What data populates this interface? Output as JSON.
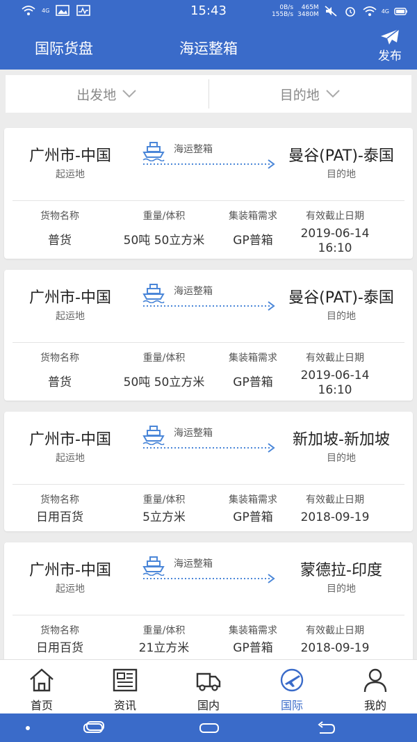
{
  "status_bar": {
    "time": "15:43",
    "net_4g_left": "4G",
    "net_4g_right": "4G",
    "speed_up": "0B/s",
    "speed_down": "155B/s",
    "mem1": "465M",
    "mem2": "3480M"
  },
  "header": {
    "left_tab": "国际货盘",
    "title": "海运整箱",
    "publish_label": "发布"
  },
  "filter": {
    "departure": "出发地",
    "destination": "目的地"
  },
  "cards": [
    {
      "origin": "广州市-中国",
      "origin_label": "起运地",
      "mode": "海运整箱",
      "destination": "曼谷(PAT)-泰国",
      "destination_label": "目的地",
      "col_headers": [
        "货物名称",
        "重量/体积",
        "集装箱需求",
        "有效截止日期"
      ],
      "cargo": "普货",
      "weight": "50吨 50立方米",
      "container": "GP普箱",
      "deadline_date": "2019-06-14",
      "deadline_time": "16:10"
    },
    {
      "origin": "广州市-中国",
      "origin_label": "起运地",
      "mode": "海运整箱",
      "destination": "曼谷(PAT)-泰国",
      "destination_label": "目的地",
      "col_headers": [
        "货物名称",
        "重量/体积",
        "集装箱需求",
        "有效截止日期"
      ],
      "cargo": "普货",
      "weight": "50吨 50立方米",
      "container": "GP普箱",
      "deadline_date": "2019-06-14",
      "deadline_time": "16:10"
    },
    {
      "origin": "广州市-中国",
      "origin_label": "起运地",
      "mode": "海运整箱",
      "destination": "新加坡-新加坡",
      "destination_label": "目的地",
      "col_headers": [
        "货物名称",
        "重量/体积",
        "集装箱需求",
        "有效截止日期"
      ],
      "cargo": "日用百货",
      "weight": "5立方米",
      "container": "GP普箱",
      "deadline_date": "2018-09-19",
      "deadline_time": ""
    },
    {
      "origin": "广州市-中国",
      "origin_label": "起运地",
      "mode": "海运整箱",
      "destination": "蒙德拉-印度",
      "destination_label": "目的地",
      "col_headers": [
        "货物名称",
        "重量/体积",
        "集装箱需求",
        "有效截止日期"
      ],
      "cargo": "日用百货",
      "weight": "21立方米",
      "container": "GP普箱",
      "deadline_date": "2018-09-19",
      "deadline_time": ""
    }
  ],
  "bottom_nav": [
    {
      "label": "首页",
      "icon": "house-icon"
    },
    {
      "label": "资讯",
      "icon": "newspaper-icon"
    },
    {
      "label": "国内",
      "icon": "truck-icon"
    },
    {
      "label": "国际",
      "icon": "plane-globe-icon",
      "active": true
    },
    {
      "label": "我的",
      "icon": "person-icon"
    }
  ],
  "colors": {
    "brand_blue": "#3a6bc9",
    "ship_blue": "#4a86d8",
    "background": "#ececec"
  }
}
